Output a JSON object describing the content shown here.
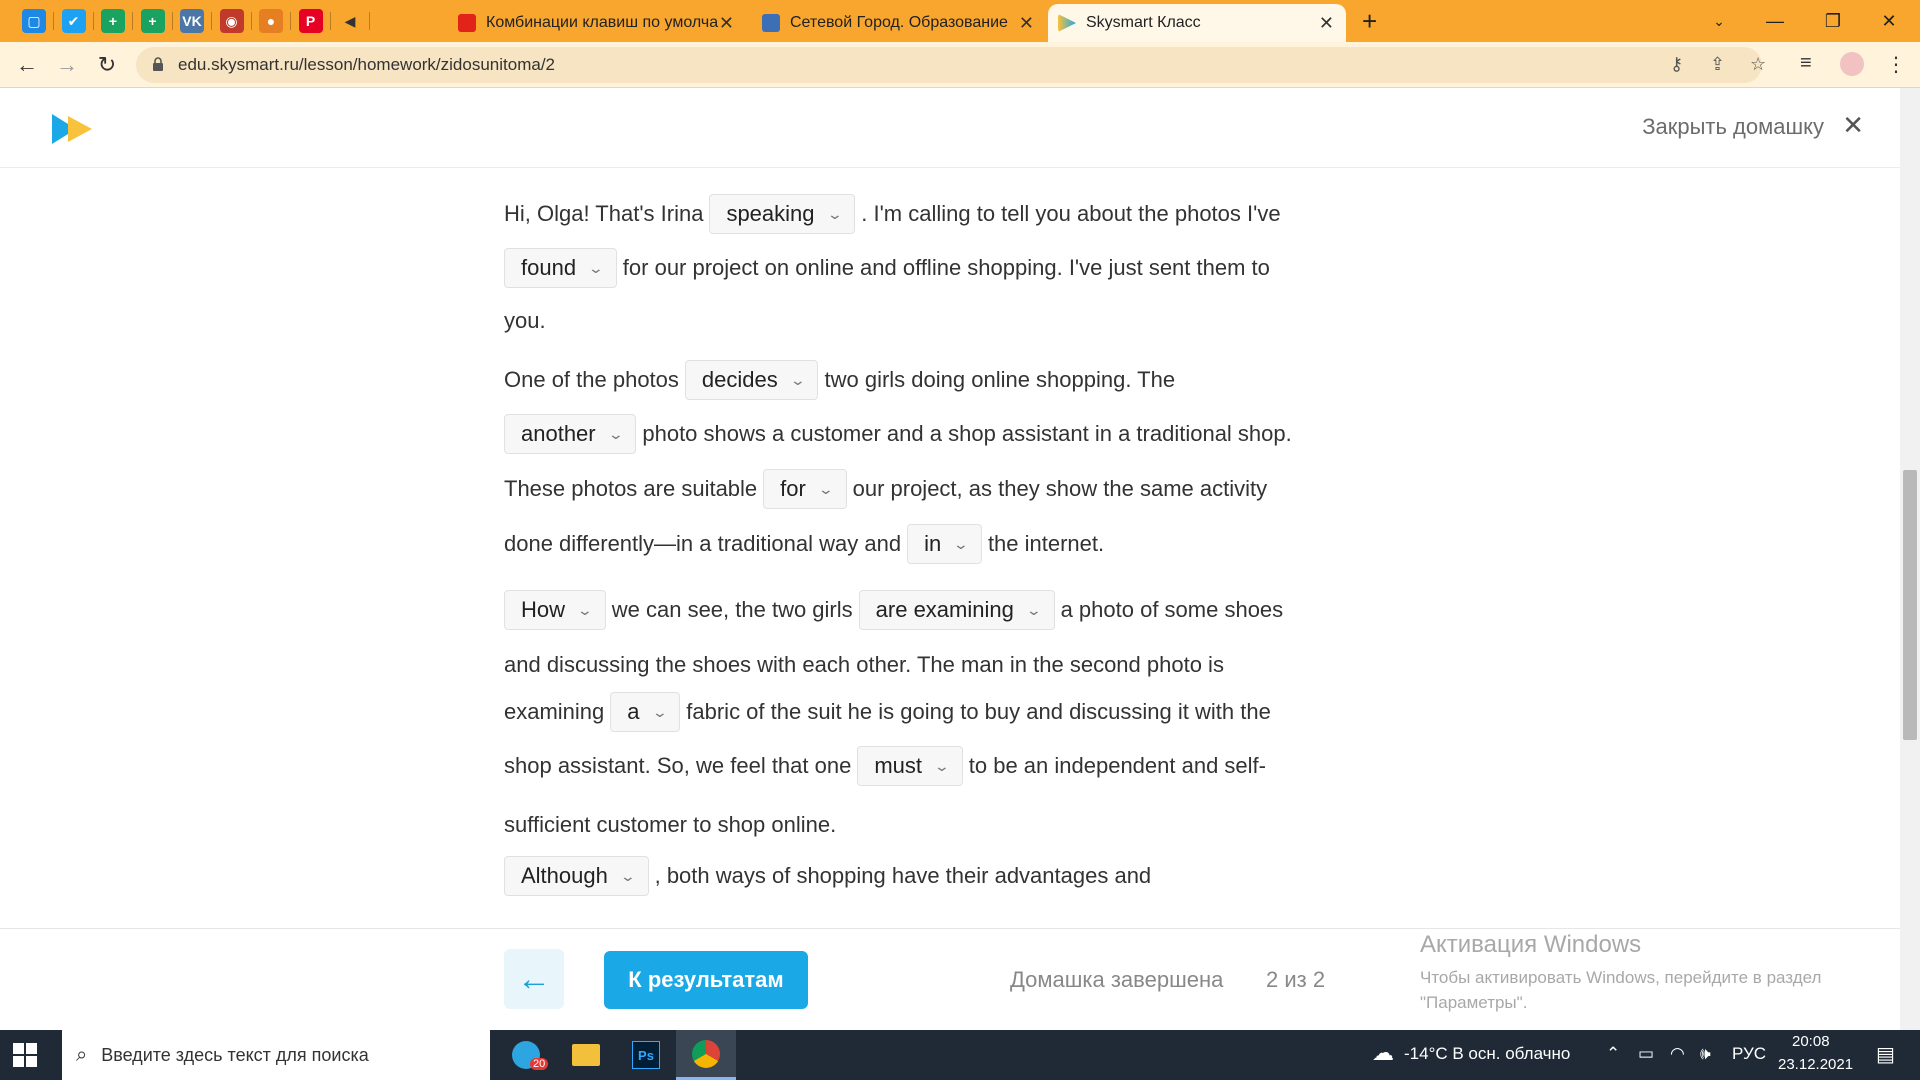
{
  "browser": {
    "pinned": [
      {
        "icon": "chat-icon",
        "glyph": "▢",
        "color": "#1e88e5"
      },
      {
        "icon": "twitter-icon",
        "glyph": "✔",
        "color": "#1da1f2"
      },
      {
        "icon": "sheets-plus-icon",
        "glyph": "+",
        "color": "#1aa260"
      },
      {
        "icon": "sheets-plus-icon",
        "glyph": "+",
        "color": "#1aa260"
      },
      {
        "icon": "vk-icon",
        "glyph": "VK",
        "color": "#4a76a8"
      },
      {
        "icon": "avatar-icon",
        "glyph": "◉",
        "color": "#c0392b"
      },
      {
        "icon": "basketball-icon",
        "glyph": "●",
        "color": "#e67e22"
      },
      {
        "icon": "pinterest-icon",
        "glyph": "P",
        "color": "#e60023"
      },
      {
        "icon": "mute-icon",
        "glyph": "◀",
        "color": "#333"
      }
    ],
    "tabs": [
      {
        "label": "Комбинации клавиш по умолча",
        "icon": "adobe-icon"
      },
      {
        "label": "Сетевой Город. Образование",
        "icon": "school-icon"
      },
      {
        "label": "Skysmart Класс",
        "icon": "skysmart-icon"
      }
    ],
    "url": "edu.skysmart.ru/lesson/homework/zidosunitoma/2"
  },
  "header": {
    "close_label": "Закрыть домашку"
  },
  "exercise": {
    "p1": {
      "l1_a": "Hi, Olga! That's Irina",
      "s1": "speaking",
      "l1_b": ". I'm calling to tell you about the photos I've",
      "s2": "found",
      "l2_b": "for our project on online and offline shopping. I've just sent them to",
      "l3": "you."
    },
    "p2": {
      "l1_a": "One of the photos",
      "s1": "decides",
      "l1_b": "two girls doing online shopping. The",
      "s2": "another",
      "l2_b": "photo shows a customer and a shop assistant in a traditional shop.",
      "l3_a": "These photos are suitable",
      "s3": "for",
      "l3_b": "our project, as they show the same activity",
      "l4_a": "done differently—in a traditional way and",
      "s4": "in",
      "l4_b": "the internet."
    },
    "p3": {
      "s1": "How",
      "l1_a": "we can see, the two girls",
      "s2": "are examining",
      "l1_b": "a photo of some shoes",
      "l2": "and discussing the shoes with each other. The man in the second photo is",
      "l3_a": "examining",
      "s3": "a",
      "l3_b": "fabric of the suit he is going to buy and discussing it with the",
      "l4_a": "shop assistant. So, we feel that one",
      "s4": "must",
      "l4_b": "to be an independent and self-",
      "l5": "sufficient customer to shop online."
    },
    "p4": {
      "s1": "Although",
      "l1_b": ", both ways of shopping have their advantages and"
    }
  },
  "footer": {
    "results_label": "К результатам",
    "status": "Домашка завершена",
    "pager": "2 из 2"
  },
  "activation": {
    "title": "Активация Windows",
    "line1": "Чтобы активировать Windows, перейдите в раздел",
    "line2": "\"Параметры\"."
  },
  "taskbar": {
    "search_placeholder": "Введите здесь текст для поиска",
    "telegram_badge": "20",
    "weather": "-14°C  В осн. облачно",
    "lang": "РУС",
    "time": "20:08",
    "date": "23.12.2021"
  }
}
